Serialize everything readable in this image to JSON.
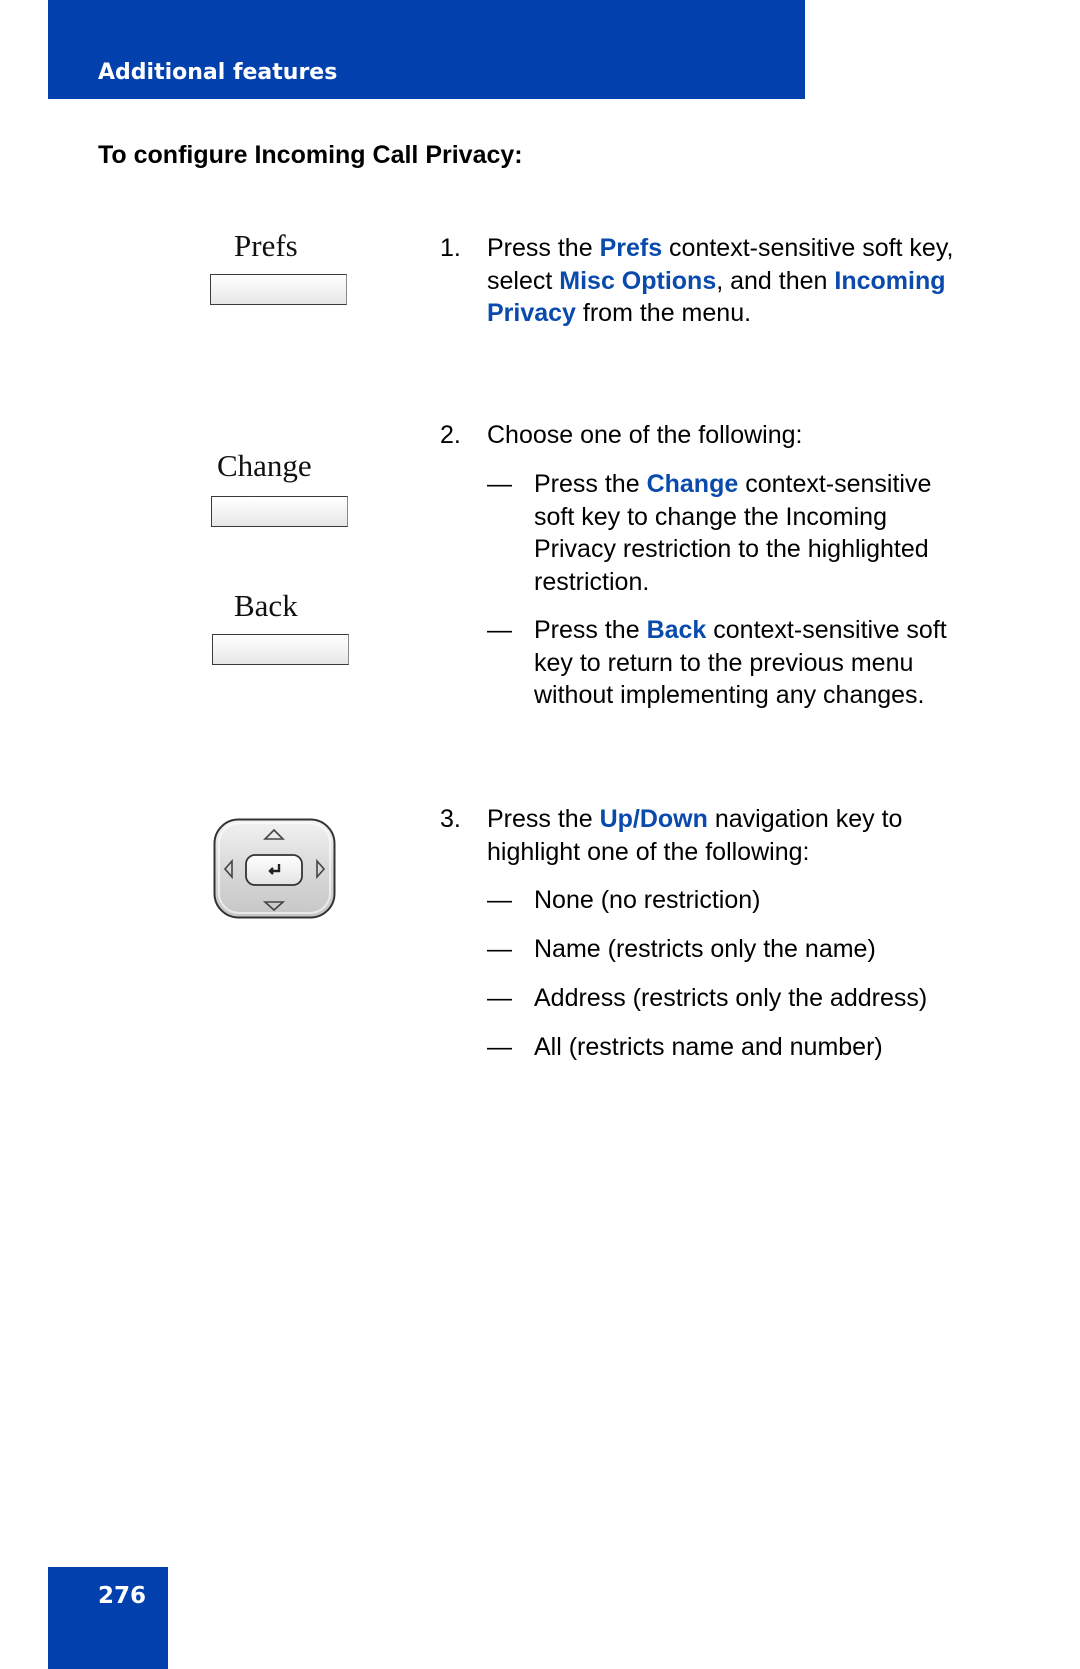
{
  "header": {
    "title": "Additional features"
  },
  "subheading": "To configure Incoming Call Privacy:",
  "soft_keys": [
    {
      "label": "Prefs"
    },
    {
      "label": "Change"
    },
    {
      "label": "Back"
    }
  ],
  "nav_key": {
    "icons": [
      "up-arrow-icon",
      "down-arrow-icon",
      "left-arrow-icon",
      "right-arrow-icon",
      "enter-icon"
    ]
  },
  "steps": [
    {
      "number": "1.",
      "parts": [
        {
          "text": "Press the ",
          "highlight": false
        },
        {
          "text": "Prefs",
          "highlight": true
        },
        {
          "text": " context-sensitive soft key, select ",
          "highlight": false
        },
        {
          "text": "Misc Options",
          "highlight": true
        },
        {
          "text": ", and then ",
          "highlight": false
        },
        {
          "text": "Incoming Privacy",
          "highlight": true
        },
        {
          "text": " from the menu.",
          "highlight": false
        }
      ]
    },
    {
      "number": "2.",
      "text": "Choose one of the following:",
      "bullets": [
        {
          "dash": "—",
          "parts": [
            {
              "text": "Press the ",
              "highlight": false
            },
            {
              "text": "Change",
              "highlight": true
            },
            {
              "text": " context-sensitive soft key to change the Incoming Privacy restriction to the highlighted restriction.",
              "highlight": false
            }
          ]
        },
        {
          "dash": "—",
          "parts": [
            {
              "text": "Press the ",
              "highlight": false
            },
            {
              "text": "Back",
              "highlight": true
            },
            {
              "text": " context-sensitive soft key to return to the previous menu without implementing any changes.",
              "highlight": false
            }
          ]
        }
      ]
    },
    {
      "number": "3.",
      "parts": [
        {
          "text": "Press the ",
          "highlight": false
        },
        {
          "text": "Up/Down",
          "highlight": true
        },
        {
          "text": " navigation key to highlight one of the following:",
          "highlight": false
        }
      ],
      "bullets": [
        {
          "dash": "—",
          "text": "None (no restriction)"
        },
        {
          "dash": "—",
          "text": "Name (restricts only the name)"
        },
        {
          "dash": "—",
          "text": "Address (restricts only the address)"
        },
        {
          "dash": "—",
          "text": "All (restricts name and number)"
        }
      ]
    }
  ],
  "footer": {
    "page_number": "276"
  },
  "colors": {
    "brand_blue": "#0241ad",
    "highlight_blue": "#0a4aad"
  }
}
